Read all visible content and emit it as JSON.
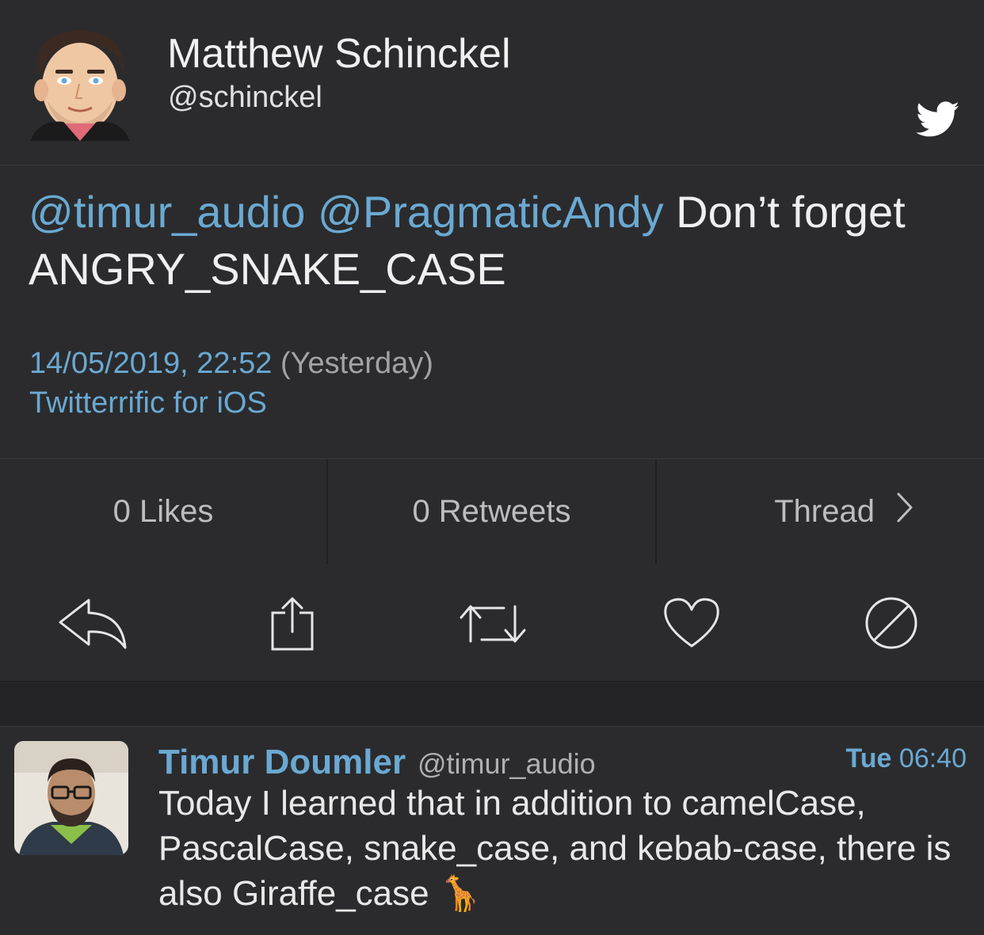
{
  "tweet": {
    "author_name": "Matthew Schinckel",
    "author_handle": "@schinckel",
    "mention_1": "@timur_audio",
    "mention_2": "@PragmaticAndy",
    "text_rest": " Don’t forget ANGRY_SNAKE_CASE",
    "date": "14/05/2019, 22:52",
    "relative": "(Yesterday)",
    "client": "Twitterrific for iOS"
  },
  "stats": {
    "likes": "0 Likes",
    "retweets": "0 Retweets",
    "thread": "Thread"
  },
  "actions": [
    "reply-icon",
    "share-icon",
    "retweet-icon",
    "like-icon",
    "mute-icon"
  ],
  "reply": {
    "name": "Timur Doumler",
    "handle": "@timur_audio",
    "day": "Tue",
    "time": "06:40",
    "text": "Today I learned that in addition to camelCase, PascalCase, snake_case, and kebab-case, there is also Giraffe_case",
    "emoji": "🦒"
  },
  "colors": {
    "background": "#232325",
    "panel": "#2b2b2d",
    "link": "#6aa9d2",
    "text": "#efefef"
  }
}
